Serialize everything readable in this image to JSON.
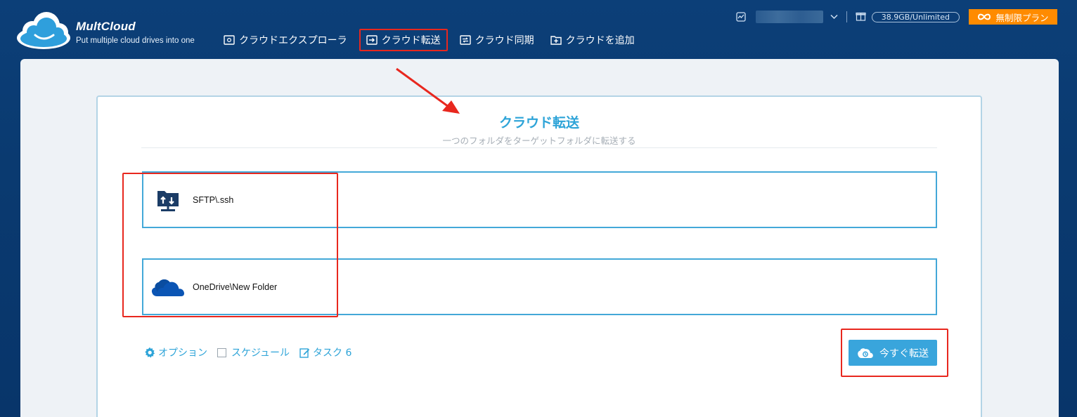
{
  "brand": {
    "name": "MultCloud",
    "tagline": "Put multiple cloud drives into one"
  },
  "nav": {
    "items": [
      {
        "label": "クラウドエクスプローラ",
        "icon": "cloud-explorer-icon"
      },
      {
        "label": "クラウド転送",
        "icon": "cloud-transfer-icon",
        "active": true
      },
      {
        "label": "クラウド同期",
        "icon": "cloud-sync-icon"
      },
      {
        "label": "クラウドを追加",
        "icon": "add-cloud-icon"
      }
    ]
  },
  "account": {
    "quota": "38.9GB/Unlimited",
    "upgrade_label": "無制限プラン"
  },
  "transfer": {
    "title": "クラウド転送",
    "subtitle": "一つのフォルダをターゲットフォルダに転送する",
    "source_path": "SFTP\\.ssh",
    "target_path": "OneDrive\\New Folder"
  },
  "options": {
    "option_label": "オプション",
    "schedule_label": "スケジュール",
    "task_label": "タスク 6"
  },
  "actions": {
    "transfer_now_label": "今すぐ転送"
  },
  "colors": {
    "accent": "#39a5dc",
    "header_bg": "#0a3a70",
    "upgrade": "#ff8b00",
    "highlight": "#e8271e"
  }
}
